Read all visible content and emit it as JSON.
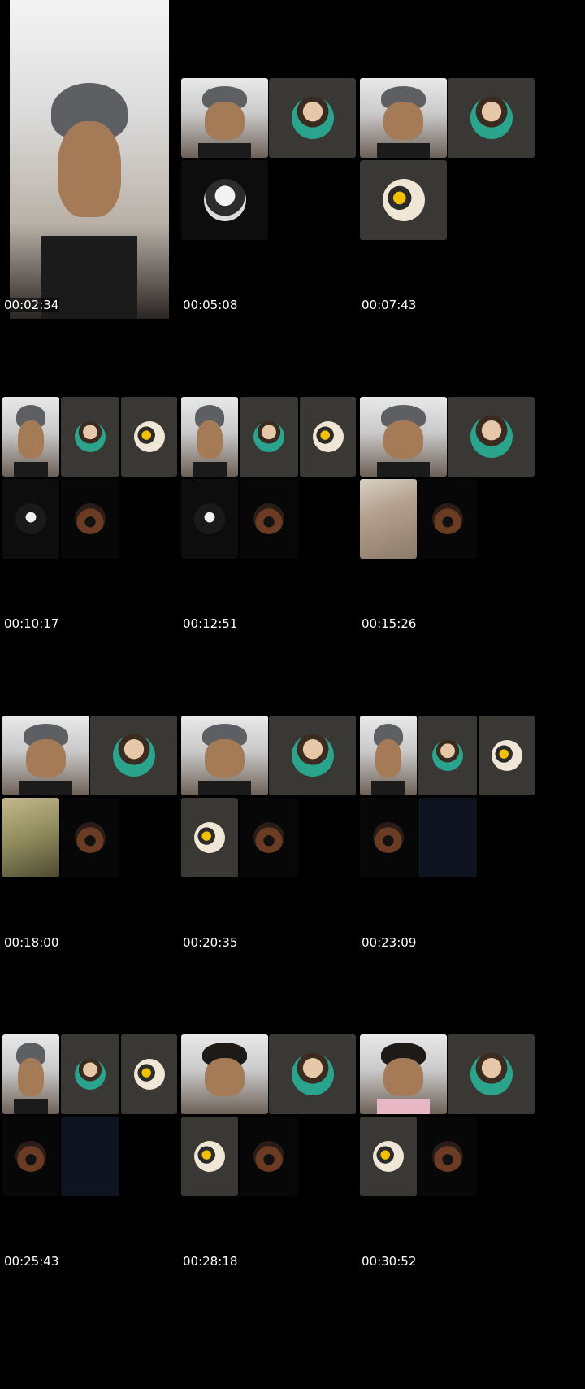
{
  "timestamps": [
    "00:02:34",
    "00:05:08",
    "00:07:43",
    "00:10:17",
    "00:12:51",
    "00:15:26",
    "00:18:00",
    "00:20:35",
    "00:23:09",
    "00:25:43",
    "00:28:18",
    "00:30:52"
  ]
}
